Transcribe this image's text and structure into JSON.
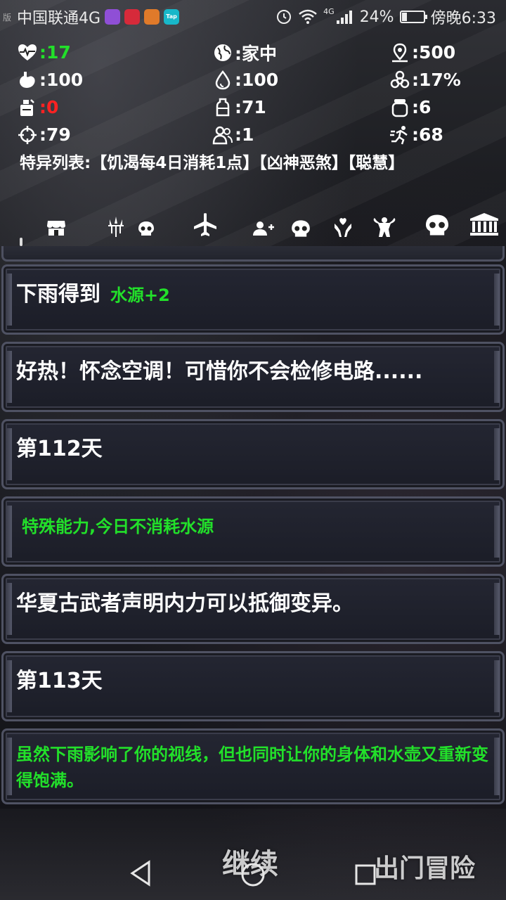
{
  "statusbar": {
    "edge": "版",
    "carrier": "中国联通4G",
    "signal_type": "4G",
    "battery_percent": "24%",
    "battery_level": 0.24,
    "time": "傍晚6:33",
    "app_icons": [
      {
        "name": "app-icon-purple",
        "color": "#8f4fd6",
        "label": ""
      },
      {
        "name": "app-icon-red",
        "color": "#d62a3a",
        "label": ""
      },
      {
        "name": "app-icon-orange",
        "color": "#e07a2a",
        "label": ""
      },
      {
        "name": "app-icon-tap",
        "color": "#18b7c9",
        "label": "Tap"
      }
    ]
  },
  "stats": {
    "health": ":17",
    "location": ":家中",
    "distance": ":500",
    "stomach": ":100",
    "water": ":100",
    "infection": ":17%",
    "food_item": ":0",
    "bottle": ":71",
    "container": ":6",
    "aim": ":79",
    "people": ":1",
    "speed": ":68"
  },
  "traits": "特异列表:【饥渴每4日消耗1点】【凶神恶煞】【聪慧】",
  "nav_icons": [
    "shop-icon",
    "trident-icon",
    "skull-icon",
    "airplane-icon",
    "add-person-icon",
    "skull-icon",
    "heart-hands-icon",
    "muscle-icon",
    "big-skull-icon",
    "bank-icon"
  ],
  "log": [
    {
      "text": "下雨得到",
      "extra": "水源+2"
    },
    {
      "text": "好热！怀念空调！可惜你不会检修电路......"
    },
    {
      "text": "第112天"
    },
    {
      "text": "特殊能力,今日不消耗水源"
    },
    {
      "text": "华夏古武者声明内力可以抵御变异。"
    },
    {
      "text": "第113天"
    },
    {
      "text": "虽然下雨影响了你的视线，但也同时让你的身体和水壶又重新变得饱满。"
    }
  ],
  "buttons": {
    "continue": "继续",
    "adventure": "出门冒险"
  },
  "colors": {
    "green": "#22e02a",
    "red": "#ff2222"
  }
}
